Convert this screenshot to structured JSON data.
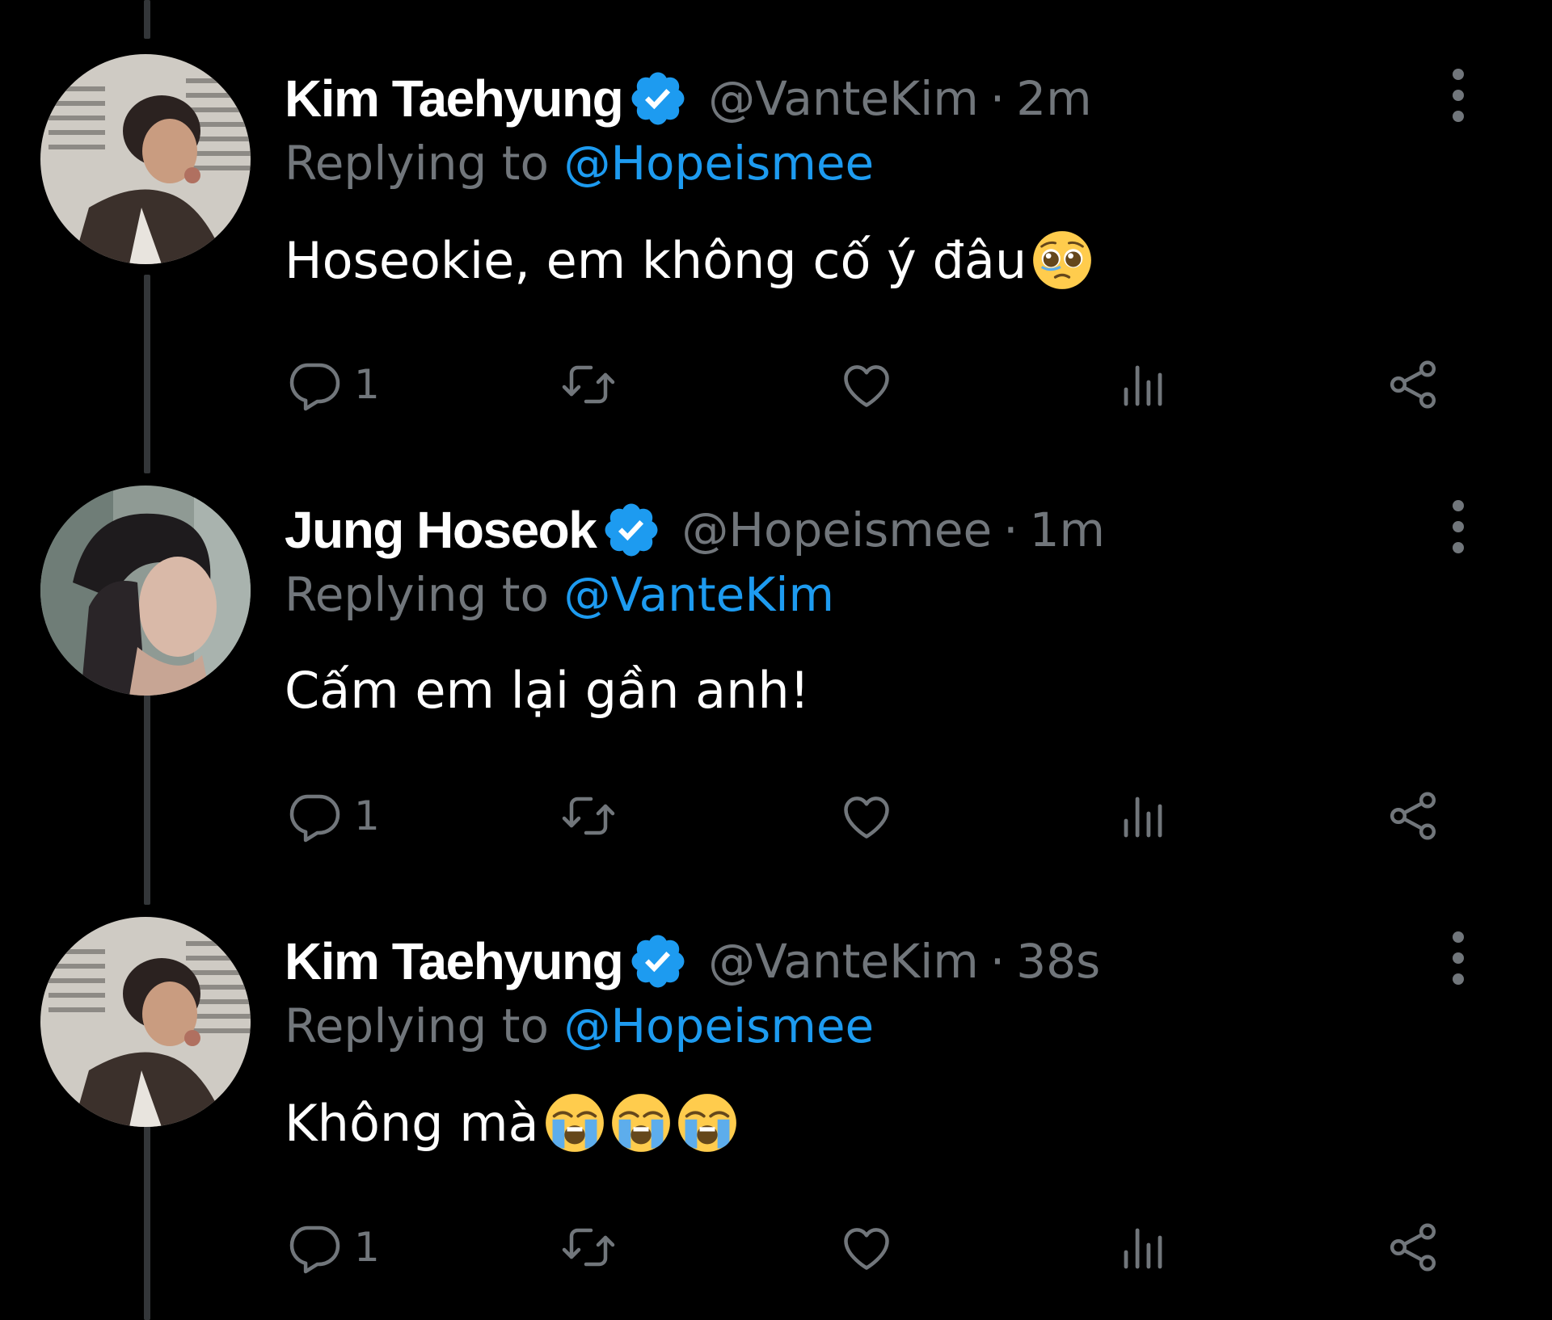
{
  "colors": {
    "background": "#000000",
    "text": "#ffffff",
    "secondary": "#71767b",
    "link": "#1d9bf0",
    "verified": "#1d9bf0"
  },
  "tweets": [
    {
      "display_name": "Kim Taehyung",
      "verified_icon": "verified-badge-icon",
      "handle": "@VanteKim",
      "separator": "·",
      "time": "2m",
      "replying_prefix": "Replying to",
      "replying_to": "@Hopeismee",
      "text": "Hoseokie, em không cố ý đâu",
      "emojis": [
        "pleading-face-icon"
      ],
      "reply_count": "1"
    },
    {
      "display_name": "Jung Hoseok",
      "verified_icon": "verified-badge-icon",
      "handle": "@Hopeismee",
      "separator": "·",
      "time": "1m",
      "replying_prefix": "Replying to",
      "replying_to": "@VanteKim",
      "text": "Cấm em lại gần anh!",
      "emojis": [],
      "reply_count": "1"
    },
    {
      "display_name": "Kim Taehyung",
      "verified_icon": "verified-badge-icon",
      "handle": "@VanteKim",
      "separator": "·",
      "time": "38s",
      "replying_prefix": "Replying to",
      "replying_to": "@Hopeismee",
      "text": "Không mà",
      "emojis": [
        "loudly-crying-face-icon",
        "loudly-crying-face-icon",
        "loudly-crying-face-icon"
      ],
      "reply_count": "1"
    }
  ]
}
